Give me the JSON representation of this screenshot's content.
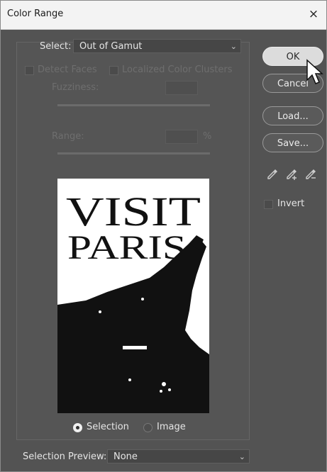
{
  "window": {
    "title": "Color Range",
    "close_glyph": "×"
  },
  "select": {
    "label": "Select:",
    "value": "Out of Gamut"
  },
  "options": {
    "detect_faces": "Detect Faces",
    "localized_color_clusters": "Localized Color Clusters",
    "fuzziness_label": "Fuzziness:",
    "range_label": "Range:",
    "range_unit": "%"
  },
  "preview": {
    "text_line1": "VISIT",
    "text_line2": "PARIS",
    "selection_label": "Selection",
    "image_label": "Image",
    "mode": "Selection"
  },
  "buttons": {
    "ok": "OK",
    "cancel": "Cancel",
    "load": "Load...",
    "save": "Save..."
  },
  "invert": {
    "label": "Invert",
    "checked": false
  },
  "selection_preview": {
    "label": "Selection Preview:",
    "value": "None"
  },
  "icons": [
    "eyedropper-icon",
    "eyedropper-plus-icon",
    "eyedropper-minus-icon",
    "pointer-cursor-icon"
  ],
  "colors": {
    "dialog_bg": "#535353",
    "titlebar_bg": "#f3f3f3",
    "primary_button": "#dcdcdc"
  }
}
